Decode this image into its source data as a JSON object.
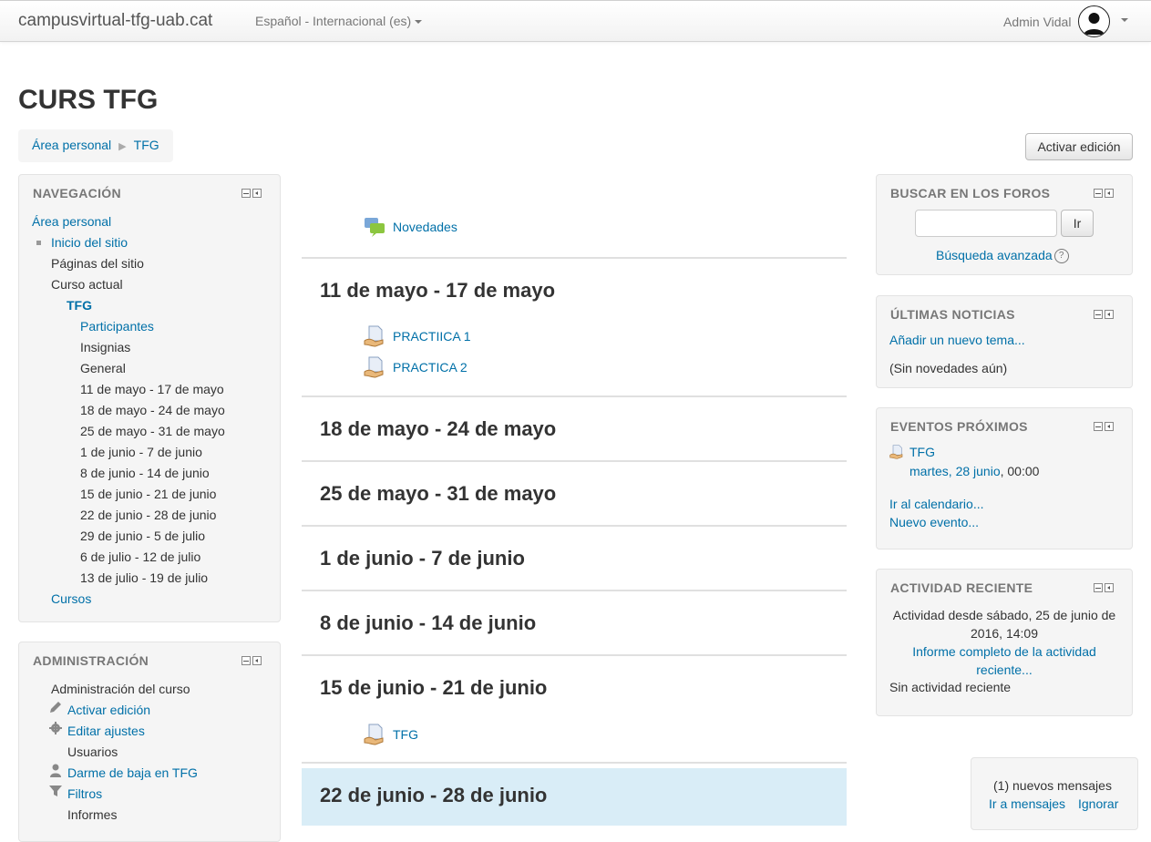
{
  "navbar": {
    "brand": "campusvirtual-tfg-uab.cat",
    "language": "Español - Internacional (es)",
    "user_name": "Admin Vidal"
  },
  "header": {
    "title": "CURS TFG",
    "breadcrumb": [
      "Área personal",
      "TFG"
    ],
    "edit_button": "Activar edición"
  },
  "navigation_block": {
    "title": "NAVEGACIÓN",
    "items": [
      "Área personal",
      "Inicio del sitio",
      "Páginas del sitio",
      "Curso actual",
      "TFG",
      "Participantes",
      "Insignias",
      "General",
      "11 de mayo - 17 de mayo",
      "18 de mayo - 24 de mayo",
      "25 de mayo - 31 de mayo",
      "1 de junio - 7 de junio",
      "8 de junio - 14 de junio",
      "15 de junio - 21 de junio",
      "22 de junio - 28 de junio",
      "29 de junio - 5 de julio",
      "6 de julio - 12 de julio",
      "13 de julio - 19 de julio",
      "Cursos"
    ]
  },
  "admin_block": {
    "title": "ADMINISTRACIÓN",
    "items": [
      "Administración del curso",
      "Activar edición",
      "Editar ajustes",
      "Usuarios",
      "Darme de baja en TFG",
      "Filtros",
      "Informes"
    ]
  },
  "main": {
    "news_forum": "Novedades",
    "sections": [
      {
        "title": "11 de mayo - 17 de mayo",
        "activities": [
          "PRACTIICA 1",
          "PRACTICA 2"
        ]
      },
      {
        "title": "18 de mayo - 24 de mayo",
        "activities": []
      },
      {
        "title": "25 de mayo - 31 de mayo",
        "activities": []
      },
      {
        "title": "1 de junio - 7 de junio",
        "activities": []
      },
      {
        "title": "8 de junio - 14 de junio",
        "activities": []
      },
      {
        "title": "15 de junio - 21 de junio",
        "activities": [
          "TFG"
        ]
      },
      {
        "title": "22 de junio - 28 de junio",
        "activities": [],
        "current": true
      }
    ]
  },
  "forum_search": {
    "title": "BUSCAR EN LOS FOROS",
    "go_label": "Ir",
    "advanced": "Búsqueda avanzada"
  },
  "latest_news": {
    "title": "ÚLTIMAS NOTICIAS",
    "add_topic": "Añadir un nuevo tema...",
    "empty": "(Sin novedades aún)"
  },
  "upcoming_events": {
    "title": "EVENTOS PRÓXIMOS",
    "event_name": "TFG",
    "event_date": "martes, 28 junio",
    "event_time": ", 00:00",
    "calendar_link": "Ir al calendario...",
    "new_event": "Nuevo evento..."
  },
  "recent_activity": {
    "title": "ACTIVIDAD RECIENTE",
    "since_line1": "Actividad desde sábado, 25 de junio de",
    "since_line2": "2016, 14:09",
    "report_line1": "Informe completo de la actividad",
    "report_line2": "reciente...",
    "empty": "Sin actividad reciente"
  },
  "messages": {
    "text": "(1) nuevos mensajes",
    "go": "Ir a mensajes",
    "ignore": "Ignorar"
  },
  "colors": {
    "link": "#0070a8",
    "current_section": "#d9edf7",
    "block_bg": "#f5f5f5"
  }
}
